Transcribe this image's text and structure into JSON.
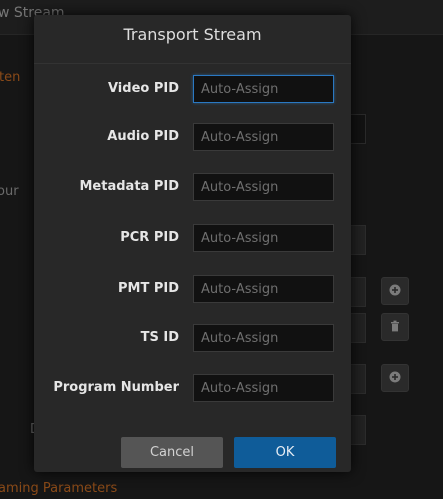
{
  "background": {
    "window_title": "w Stream",
    "section_top": "ten",
    "section_mid": "our",
    "label_bottom_left": "D",
    "section_bottom": "aming Parameters"
  },
  "modal": {
    "title": "Transport Stream",
    "fields": [
      {
        "label": "Video PID",
        "placeholder": "Auto-Assign",
        "value": ""
      },
      {
        "label": "Audio PID",
        "placeholder": "Auto-Assign",
        "value": ""
      },
      {
        "label": "Metadata PID",
        "placeholder": "Auto-Assign",
        "value": ""
      },
      {
        "label": "PCR PID",
        "placeholder": "Auto-Assign",
        "value": ""
      },
      {
        "label": "PMT PID",
        "placeholder": "Auto-Assign",
        "value": ""
      },
      {
        "label": "TS ID",
        "placeholder": "Auto-Assign",
        "value": ""
      },
      {
        "label": "Program Number",
        "placeholder": "Auto-Assign",
        "value": ""
      }
    ],
    "cancel_label": "Cancel",
    "ok_label": "OK"
  },
  "colors": {
    "accent": "#0f5c99",
    "focus_border": "#2a78c2",
    "section_orange": "#8a4a18"
  },
  "icons": {
    "add": "plus-circle-icon",
    "delete": "trash-icon"
  }
}
